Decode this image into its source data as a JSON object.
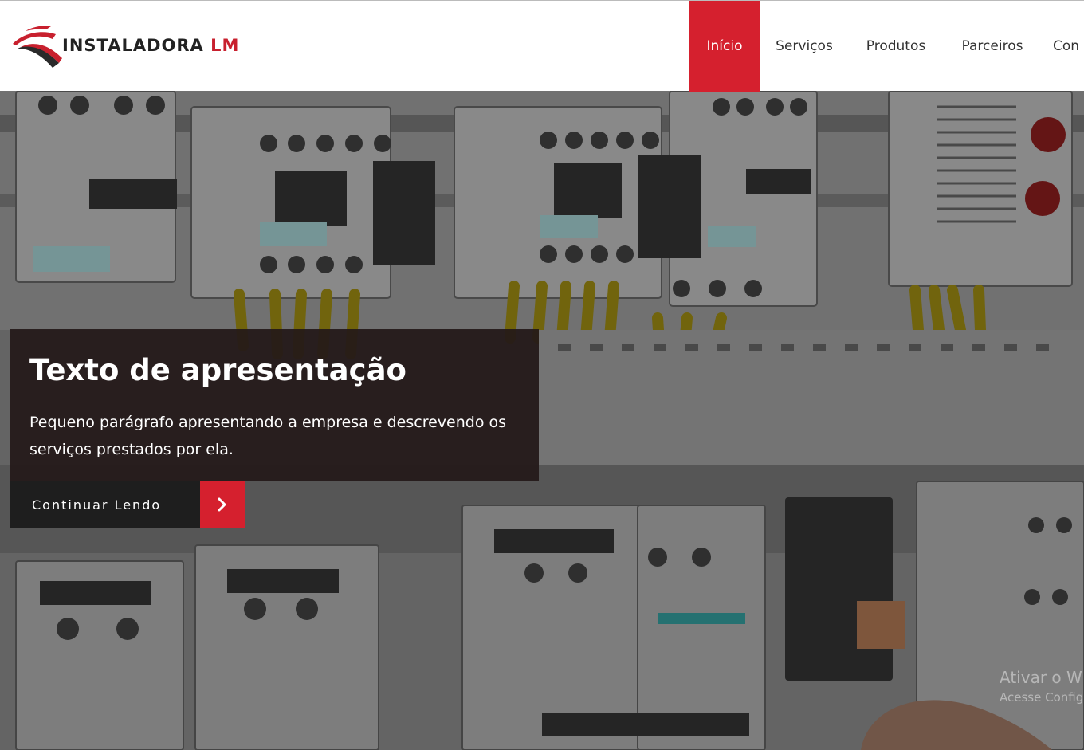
{
  "brand": {
    "name": "INSTALADORA",
    "suffix": "LM",
    "logo_icon": "swoosh-logo-icon"
  },
  "nav": {
    "items": [
      {
        "label": "Início",
        "active": true
      },
      {
        "label": "Serviços"
      },
      {
        "label": "Produtos"
      },
      {
        "label": "Parceiros"
      },
      {
        "label": "Con"
      }
    ]
  },
  "hero": {
    "title": "Texto de apresentação",
    "text": "Pequeno parágrafo apresentando a empresa e descrevendo os serviços prestados por ela.",
    "cta_label": "Continuar Lendo",
    "cta_icon": "chevron-right-icon"
  },
  "watermark": {
    "line1": "Ativar o W",
    "line2": "Acesse Config"
  },
  "colors": {
    "accent": "#d5202e",
    "overlay": "#231919",
    "cta_dark": "#1e1e1e"
  }
}
